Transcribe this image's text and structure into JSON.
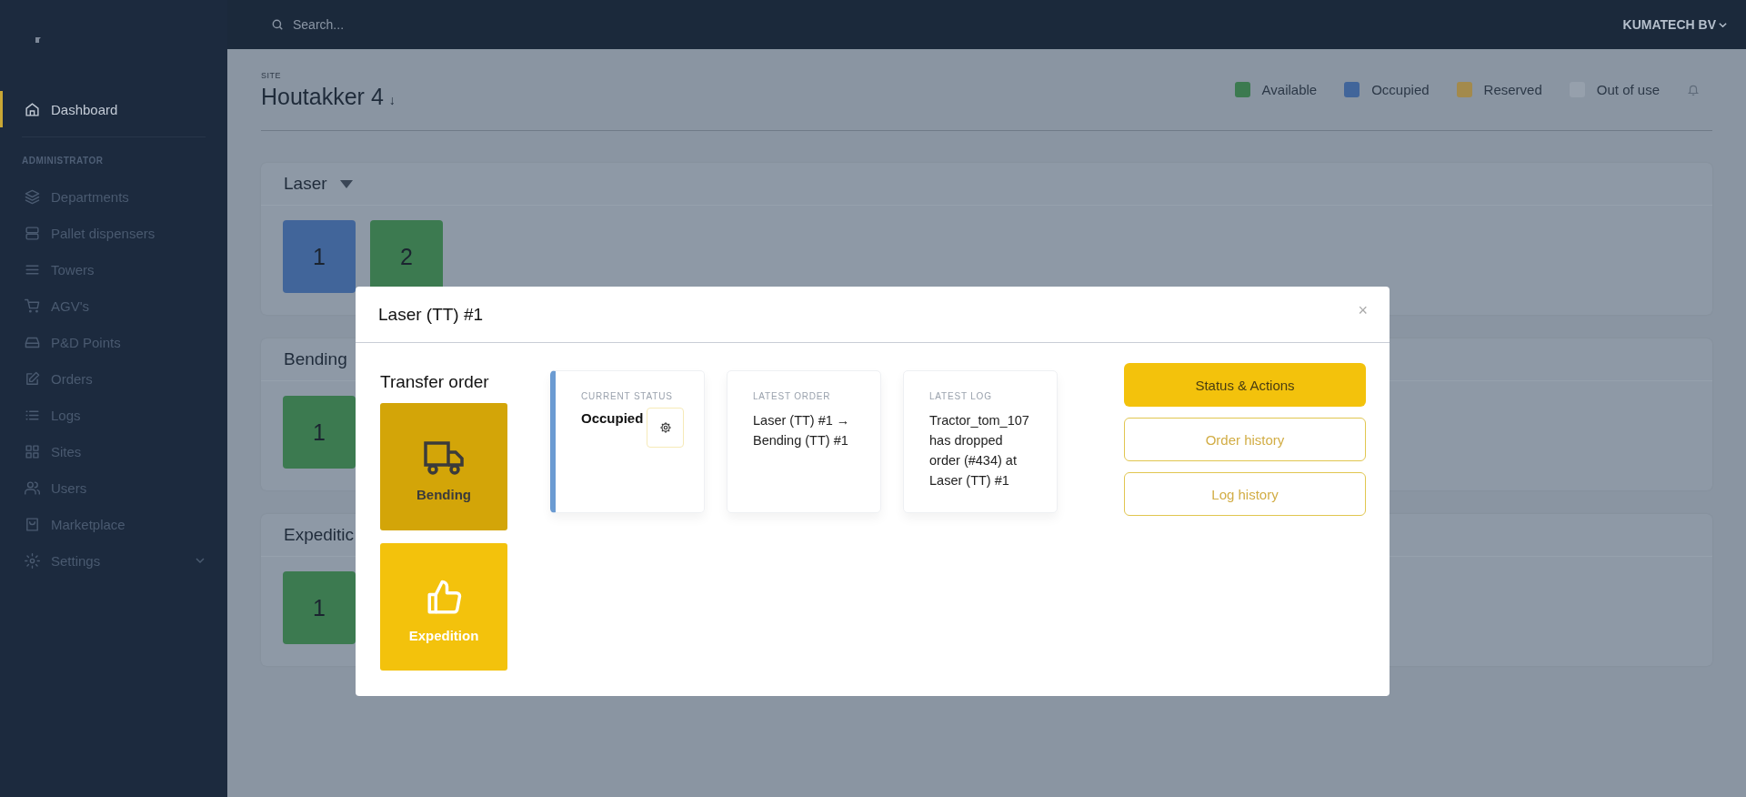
{
  "topbar": {
    "search": {
      "placeholder": "Search..."
    },
    "account": "KUMATECH BV"
  },
  "sidebar": {
    "items": [
      {
        "label": "Dashboard",
        "selected": true
      }
    ],
    "section_title": "ADMINISTRATOR",
    "admin_items": [
      {
        "label": "Departments",
        "selected": false,
        "expandable": false
      },
      {
        "label": "Pallet dispensers",
        "selected": false,
        "expandable": false
      },
      {
        "label": "Towers",
        "selected": false,
        "expandable": false
      },
      {
        "label": "AGV's",
        "selected": false,
        "expandable": false
      },
      {
        "label": "P&D Points",
        "selected": false,
        "expandable": false
      },
      {
        "label": "Orders",
        "selected": false,
        "expandable": false
      },
      {
        "label": "Logs",
        "selected": false,
        "expandable": false
      },
      {
        "label": "Sites",
        "selected": false,
        "expandable": false
      },
      {
        "label": "Users",
        "selected": false,
        "expandable": false
      },
      {
        "label": "Marketplace",
        "selected": false,
        "expandable": false
      },
      {
        "label": "Settings",
        "selected": false,
        "expandable": true
      }
    ]
  },
  "site": {
    "label": "SITE",
    "name": "Houtakker 4",
    "caret": "↓"
  },
  "legend": [
    {
      "label": "Available",
      "color": "#3c7a50"
    },
    {
      "label": "Occupied",
      "color": "#41659a"
    },
    {
      "label": "Reserved",
      "color": "#a38a4c"
    },
    {
      "label": "Out of use",
      "color": "#96a0ac"
    }
  ],
  "sections": [
    {
      "title": "Laser",
      "tiles": [
        {
          "label": "1",
          "color": "#41659a"
        },
        {
          "label": "2",
          "color": "#3c7a50"
        }
      ]
    },
    {
      "title": "Bending",
      "tiles": [
        {
          "label": "1",
          "color": "#3c7a50"
        }
      ]
    },
    {
      "title": "Expeditic",
      "tiles": [
        {
          "label": "1",
          "color": "#3c7a50"
        }
      ]
    }
  ],
  "modal": {
    "title": "Laser (TT) #1",
    "close": "×",
    "transfer_title": "Transfer order",
    "destinations": [
      {
        "label": "Bending",
        "kind": "truck",
        "selected": true
      },
      {
        "label": "Expedition",
        "kind": "thumbs",
        "selected": false
      }
    ],
    "cards": [
      {
        "kind": "status",
        "label": "CURRENT STATUS",
        "value": "Occupied",
        "color": "#6b9bd2"
      },
      {
        "kind": "text",
        "label": "LATEST ORDER",
        "value": "Laser (TT) #1 → Bending (TT) #1"
      },
      {
        "kind": "text",
        "label": "LATEST LOG",
        "value": "Tractor_tom_107 has dropped order (#434) at Laser (TT) #1"
      }
    ],
    "buttons": [
      {
        "label": "Status & Actions",
        "kind": "primary"
      },
      {
        "label": "Order history",
        "kind": "outline"
      },
      {
        "label": "Log history",
        "kind": "outline"
      }
    ]
  }
}
